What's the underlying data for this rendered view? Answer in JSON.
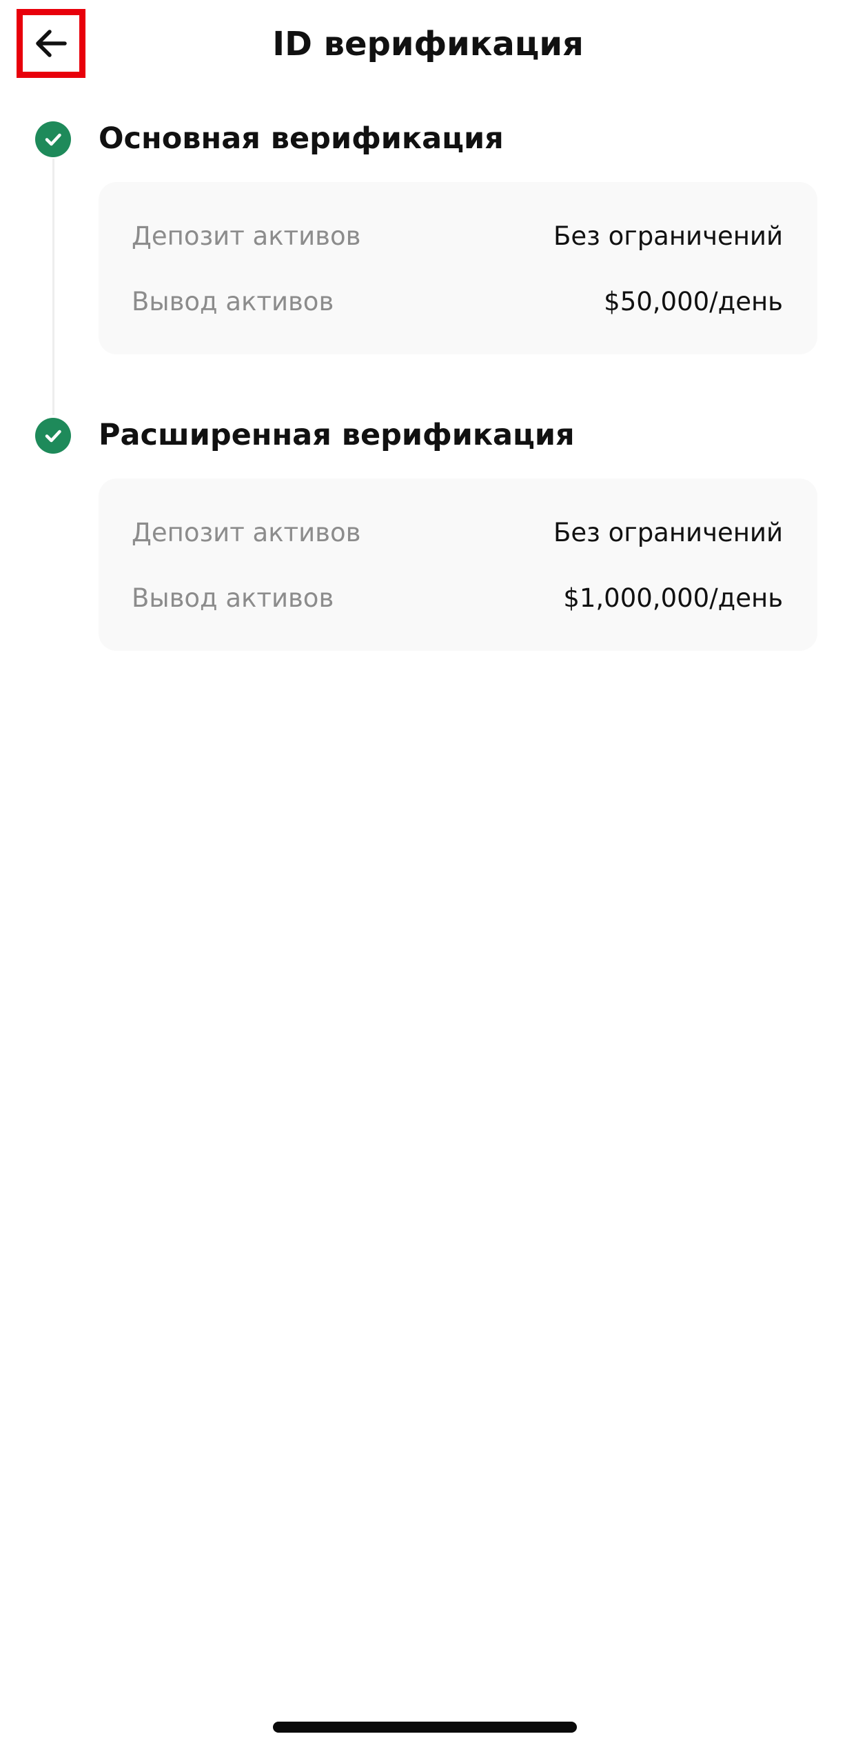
{
  "header": {
    "title": "ID верификация"
  },
  "icons": {
    "back": "arrow-left-icon",
    "check": "check-icon"
  },
  "colors": {
    "accent_green": "#1e8a5a",
    "highlight_red": "#e8000b",
    "label_gray": "#8c8c8c",
    "card_bg": "#f9f9f9"
  },
  "steps": [
    {
      "title": "Основная верификация",
      "rows": [
        {
          "label": "Депозит активов",
          "value": "Без ограничений"
        },
        {
          "label": "Вывод активов",
          "value": "$50,000/день"
        }
      ]
    },
    {
      "title": "Расширенная верификация",
      "rows": [
        {
          "label": "Депозит активов",
          "value": "Без ограничений"
        },
        {
          "label": "Вывод активов",
          "value": "$1,000,000/день"
        }
      ]
    }
  ]
}
